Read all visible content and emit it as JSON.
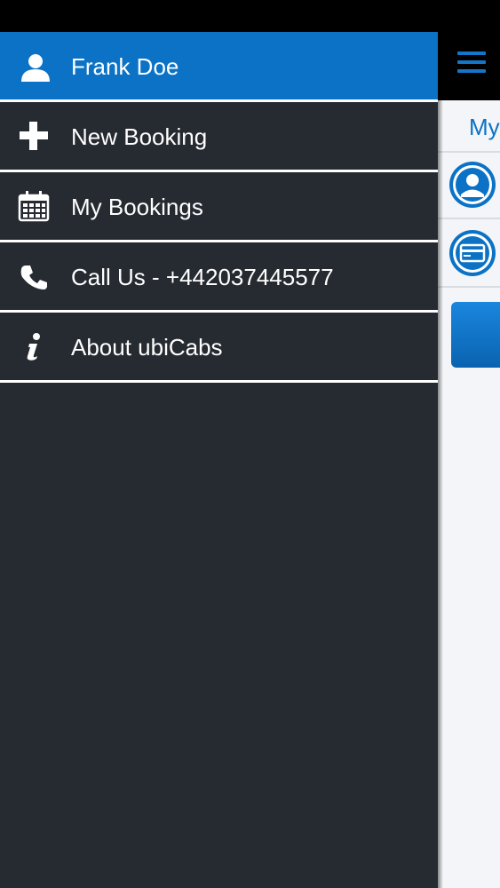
{
  "drawer": {
    "user": {
      "name": "Frank Doe",
      "icon": "user-icon"
    },
    "items": [
      {
        "label": "New Booking",
        "icon": "plus-icon"
      },
      {
        "label": "My Bookings",
        "icon": "calendar-icon"
      },
      {
        "label": "Call Us - +442037445577",
        "icon": "phone-icon"
      },
      {
        "label": "About ubiCabs",
        "icon": "info-icon"
      }
    ]
  },
  "page": {
    "title_partial": "My",
    "menu_icon": "hamburger-icon"
  },
  "colors": {
    "accent": "#0b72c5",
    "drawer_bg": "#262a31",
    "separator": "#ffffff"
  }
}
